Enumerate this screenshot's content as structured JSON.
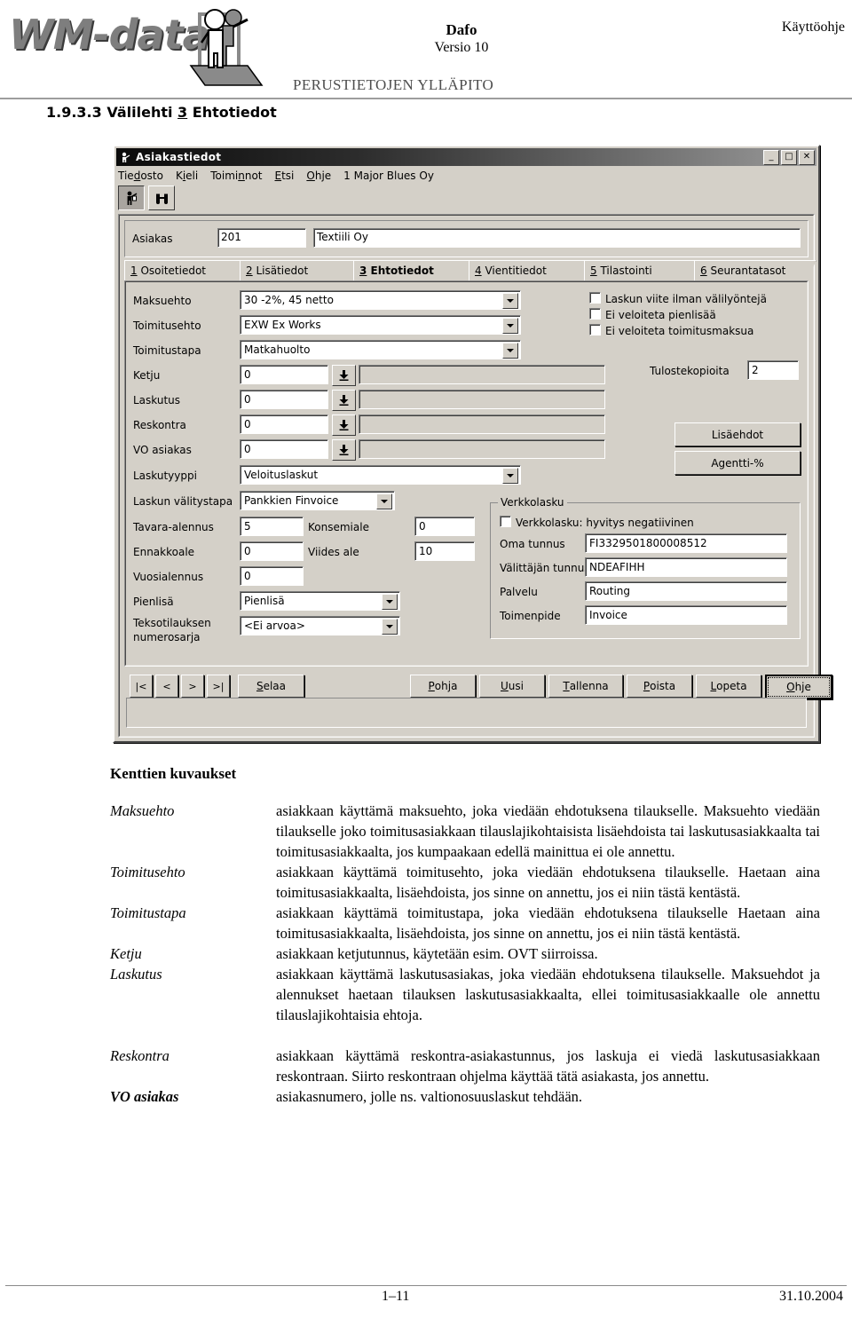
{
  "page_header": {
    "logo_text": "WM-data",
    "logo_icon": "person-presenting-icon",
    "doc_title": "Dafo",
    "doc_version": "Versio 10",
    "doc_right": "Käyttöohje",
    "doc_subtitle": "PERUSTIETOJEN YLLÄPITO",
    "section_number": "1.9.3.3",
    "section_title_pre": "Välilehti ",
    "section_title_key": "3",
    "section_title_post": " Ehtotiedot"
  },
  "window": {
    "title": "Asiakastiedot",
    "title_icon": "person-icon",
    "minimize": "_",
    "maximize": "□",
    "close": "✕",
    "menu": [
      {
        "pre": "Tie",
        "key": "d",
        "post": "osto"
      },
      {
        "pre": "K",
        "key": "i",
        "post": "eli"
      },
      {
        "pre": "Toimi",
        "key": "n",
        "post": "not"
      },
      {
        "pre": "",
        "key": "E",
        "post": "tsi"
      },
      {
        "pre": "",
        "key": "O",
        "post": "hje"
      },
      {
        "pre": "1 Major Blues Oy",
        "key": "",
        "post": ""
      }
    ],
    "toolbar": [
      {
        "name": "customer-icon",
        "pressed": true
      },
      {
        "name": "binoculars-icon",
        "pressed": false
      }
    ],
    "customer": {
      "label": "Asiakas",
      "id": "201",
      "name": "Textiili Oy"
    },
    "tabs": [
      {
        "num": "1",
        "label": " Osoitetiedot",
        "active": false
      },
      {
        "num": "2",
        "label": " Lisätiedot",
        "active": false
      },
      {
        "num": "3",
        "label": " Ehtotiedot",
        "active": true
      },
      {
        "num": "4",
        "label": " Vientitiedot",
        "active": false
      },
      {
        "num": "5",
        "label": " Tilastointi",
        "active": false
      },
      {
        "num": "6",
        "label": " Seurantatasot",
        "active": false
      }
    ],
    "form": {
      "maksuehto": {
        "label": "Maksuehto",
        "value": "30 -2%, 45 netto"
      },
      "toimitusehto": {
        "label": "Toimitusehto",
        "value": "EXW   Ex Works"
      },
      "toimitustapa": {
        "label": "Toimitustapa",
        "value": "Matkahuolto"
      },
      "ketju": {
        "label": "Ketju",
        "value": "0",
        "desc": ""
      },
      "laskutus": {
        "label": "Laskutus",
        "value": "0",
        "desc": ""
      },
      "reskontra": {
        "label": "Reskontra",
        "value": "0",
        "desc": ""
      },
      "vo_asiakas": {
        "label": "VO asiakas",
        "value": "0",
        "desc": ""
      },
      "laskutyyppi": {
        "label": "Laskutyyppi",
        "value": "Veloituslaskut"
      },
      "laskun_valitystapa": {
        "label": "Laskun välitystapa",
        "value": "Pankkien Finvoice"
      },
      "tavara_alennus": {
        "label": "Tavara-alennus",
        "value": "5"
      },
      "konsemiale": {
        "label": "Konsemiale",
        "value": "0"
      },
      "ennakkoale": {
        "label": "Ennakkoale",
        "value": "0"
      },
      "viides_ale": {
        "label": "Viides ale",
        "value": "10"
      },
      "vuosialennus": {
        "label": "Vuosialennus",
        "value": "0"
      },
      "pienlisa": {
        "label": "Pienlisä",
        "value": "Pienlisä"
      },
      "teksotilauksen": {
        "label_line1": "Teksotilauksen",
        "label_line2": "numerosarja",
        "value": "<Ei arvoa>"
      }
    },
    "checkboxes": [
      {
        "label": "Laskun viite ilman välilyöntejä",
        "checked": false
      },
      {
        "label": "Ei veloiteta pienlisää",
        "checked": false
      },
      {
        "label": "Ei veloiteta toimitusmaksua",
        "checked": false
      }
    ],
    "tulostekopioita": {
      "label": "Tulostekopioita",
      "value": "2"
    },
    "side_buttons": [
      {
        "label": "Lisäehdot"
      },
      {
        "label": "Agentti-%"
      }
    ],
    "verkkolasku": {
      "group_label": "Verkkolasku",
      "checkbox": {
        "label": "Verkkolasku: hyvitys negatiivinen",
        "checked": false
      },
      "fields": [
        {
          "label": "Oma tunnus",
          "value": "FI3329501800008512"
        },
        {
          "label": "Välittäjän tunnus",
          "value": "NDEAFIHH"
        },
        {
          "label": "Palvelu",
          "value": "Routing"
        },
        {
          "label": "Toimenpide",
          "value": "Invoice"
        }
      ]
    },
    "nav_buttons": [
      {
        "label": "|<",
        "name": "first-record-button"
      },
      {
        "label": "<",
        "name": "previous-record-button"
      },
      {
        "label": ">",
        "name": "next-record-button"
      },
      {
        "label": ">|",
        "name": "last-record-button"
      }
    ],
    "browse_button": {
      "pre": "",
      "key": "S",
      "post": "elaa"
    },
    "action_buttons": [
      {
        "pre": "",
        "key": "P",
        "post": "ohja",
        "name": "pohja-button",
        "default": false
      },
      {
        "pre": "",
        "key": "U",
        "post": "usi",
        "name": "uusi-button",
        "default": false
      },
      {
        "pre": "",
        "key": "T",
        "post": "allenna",
        "name": "tallenna-button",
        "default": false
      },
      {
        "pre": "",
        "key": "P",
        "post": "oista",
        "name": "poista-button",
        "default": false
      },
      {
        "pre": "",
        "key": "L",
        "post": "opeta",
        "name": "lopeta-button",
        "default": false
      },
      {
        "pre": "",
        "key": "O",
        "post": "hje",
        "name": "ohje-button",
        "default": true
      }
    ]
  },
  "descriptions": {
    "heading": "Kenttien kuvaukset",
    "rows": [
      {
        "term": "Maksuehto",
        "bold": false,
        "text": "asiakkaan käyttämä maksuehto, joka viedään ehdotuksena tilaukselle. Maksuehto viedään tilaukselle joko toimitusasiakkaan tilauslajikohtaisista lisäehdoista tai laskutusasiakkaalta tai toimitusasiakkaalta, jos kumpaakaan edellä mainittua ei ole annettu."
      },
      {
        "term": "Toimitusehto",
        "bold": false,
        "text": "asiakkaan käyttämä toimitusehto, joka viedään ehdotuksena tilaukselle. Haetaan aina toimitusasiakkaalta, lisäehdoista, jos sinne on annettu, jos ei niin tästä kentästä."
      },
      {
        "term": "Toimitustapa",
        "bold": false,
        "text": "asiakkaan käyttämä toimitustapa, joka viedään ehdotuksena tilaukselle Haetaan aina toimitusasiakkaalta, lisäehdoista, jos sinne on annettu, jos ei niin tästä kentästä."
      },
      {
        "term": "Ketju",
        "bold": false,
        "text": "asiakkaan ketjutunnus, käytetään esim. OVT siirroissa."
      },
      {
        "term": "Laskutus",
        "bold": false,
        "text": "asiakkaan käyttämä laskutusasiakas, joka viedään ehdotuksena tilaukselle. Maksuehdot ja alennukset haetaan tilauksen laskutusasiakkaalta, ellei toimitusasiakkaalle ole annettu tilauslajikohtaisia ehtoja."
      },
      {
        "term": "Reskontra",
        "bold": false,
        "text": "asiakkaan käyttämä reskontra-asiakastunnus, jos laskuja ei viedä laskutusasiakkaan reskontraan. Siirto reskontraan ohjelma käyttää tätä asiakasta, jos annettu."
      },
      {
        "term": "VO asiakas",
        "bold": true,
        "text": "asiakasnumero, jolle ns. valtionosuuslaskut tehdään."
      }
    ]
  },
  "footer": {
    "page": "1–11",
    "date": "31.10.2004"
  }
}
